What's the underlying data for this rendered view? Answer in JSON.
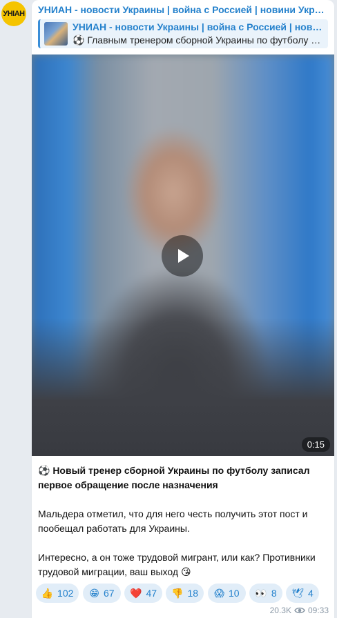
{
  "channel": {
    "avatar_text": "УНІАН",
    "name": "УНИАН - новости Украины | война с Россией | новини Україні…"
  },
  "reply": {
    "title": "УНИАН - новости Украины | война с Россией | новини…",
    "text": "⚽ Главным тренером сборной Украины по футболу с…"
  },
  "video": {
    "duration": "0:15"
  },
  "caption": {
    "headline": "⚽ Новый тренер сборной Украины по футболу записал первое обращение после назначения",
    "paragraph1": "Мальдера отметил, что для него честь получить этот пост и пообещал работать для Украины.",
    "paragraph2": "Интересно, а он тоже трудовой мигрант, или как? Противники трудовой миграции, ваш выход 😘"
  },
  "reactions": [
    {
      "emoji": "👍",
      "count": "102"
    },
    {
      "emoji": "😁",
      "count": "67"
    },
    {
      "emoji": "❤️",
      "count": "47"
    },
    {
      "emoji": "👎",
      "count": "18"
    },
    {
      "emoji": "😱",
      "count": "10"
    },
    {
      "emoji": "👀",
      "count": "8"
    },
    {
      "emoji": "🕊",
      "count": "4"
    }
  ],
  "footer": {
    "views": "20.3K",
    "time": "09:33"
  }
}
